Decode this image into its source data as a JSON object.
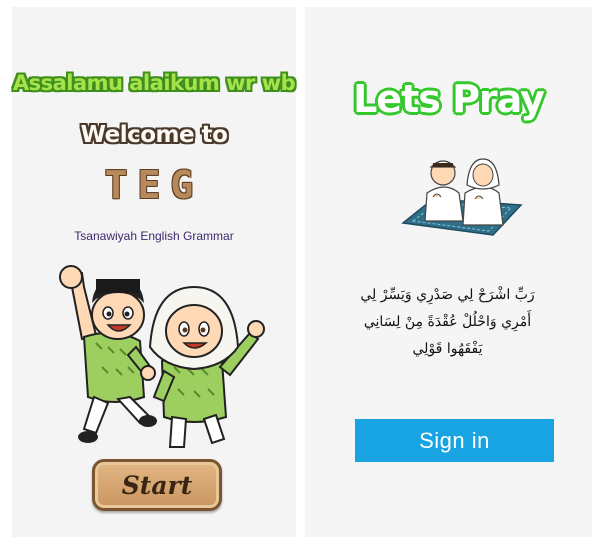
{
  "welcome_screen": {
    "greeting": "Assalamu alaikum wr wb",
    "welcome": "Welcome to",
    "app_abbr": "TEG",
    "app_full_name": "Tsanawiyah English Grammar",
    "start_label": "Start",
    "illustration": "muslim-kids-cheering"
  },
  "login_screen": {
    "title": "Lets Pray",
    "illustration": "kids-praying-on-mat",
    "prayer_lines": [
      "رَبِّ اشْرَحْ لِي صَدْرِي وَيَسِّرْ لِي",
      "أَمْرِي وَاحْلُلْ عُقْدَةً مِنْ لِسَانِي",
      "يَفْقَهُوا قَوْلِي"
    ],
    "signin_label": "Sign in"
  },
  "colors": {
    "greeting_fill": "#a6e34a",
    "greeting_outline": "#3f8f1e",
    "title_outline": "#35c82d",
    "signin_bg": "#18a3e2",
    "start_bg": "#c99560"
  }
}
